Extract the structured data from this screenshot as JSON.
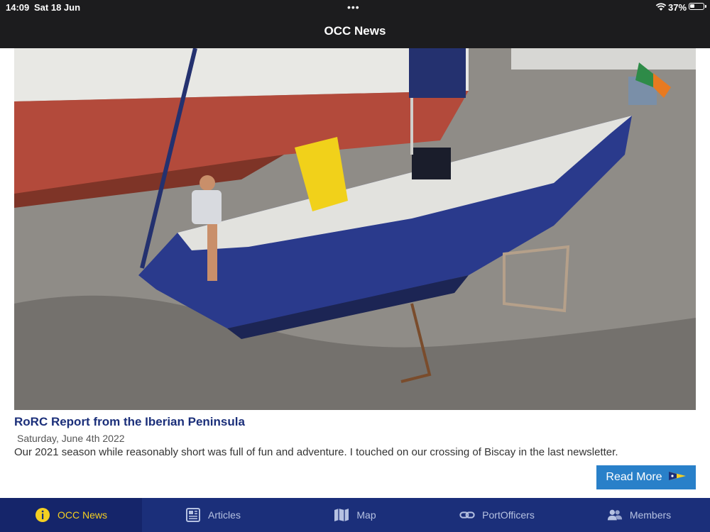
{
  "status_bar": {
    "time": "14:09",
    "date": "Sat 18 Jun",
    "battery_percent": "37%",
    "battery_level": 0.37
  },
  "nav": {
    "title": "OCC News"
  },
  "article": {
    "image_icon": "boat-photo",
    "title": "RoRC Report from the Iberian Peninsula",
    "date": "Saturday, June 4th 2022",
    "excerpt": "Our 2021 season while reasonably short was full of fun and adventure. I touched on our crossing of Biscay in the last newsletter.",
    "read_more": "Read More",
    "read_more_icon": "burgee-flag-icon"
  },
  "tabs": [
    {
      "label": "OCC News",
      "icon": "info-icon",
      "active": true
    },
    {
      "label": "Articles",
      "icon": "newspaper-icon",
      "active": false
    },
    {
      "label": "Map",
      "icon": "map-icon",
      "active": false
    },
    {
      "label": "PortOfficers",
      "icon": "link-icon",
      "active": false
    },
    {
      "label": "Members",
      "icon": "people-icon",
      "active": false
    }
  ],
  "colors": {
    "tab_bar": "#1b2f7a",
    "tab_active": "#f4cf21",
    "button": "#2980c9",
    "title_text": "#1b2f7a"
  }
}
